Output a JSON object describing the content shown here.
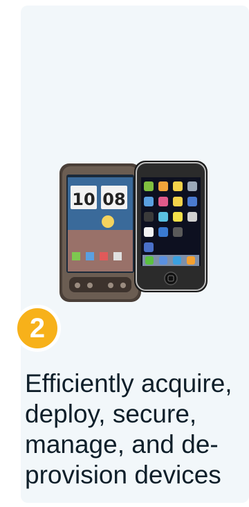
{
  "step": {
    "number": "2",
    "badge_color": "#f7b11a"
  },
  "image": {
    "icon": "smartphones-image",
    "android_clock_hour": "10",
    "android_clock_minute": "08"
  },
  "description": "Efficiently acquire, deploy, secure, manage, and de-provision devices"
}
